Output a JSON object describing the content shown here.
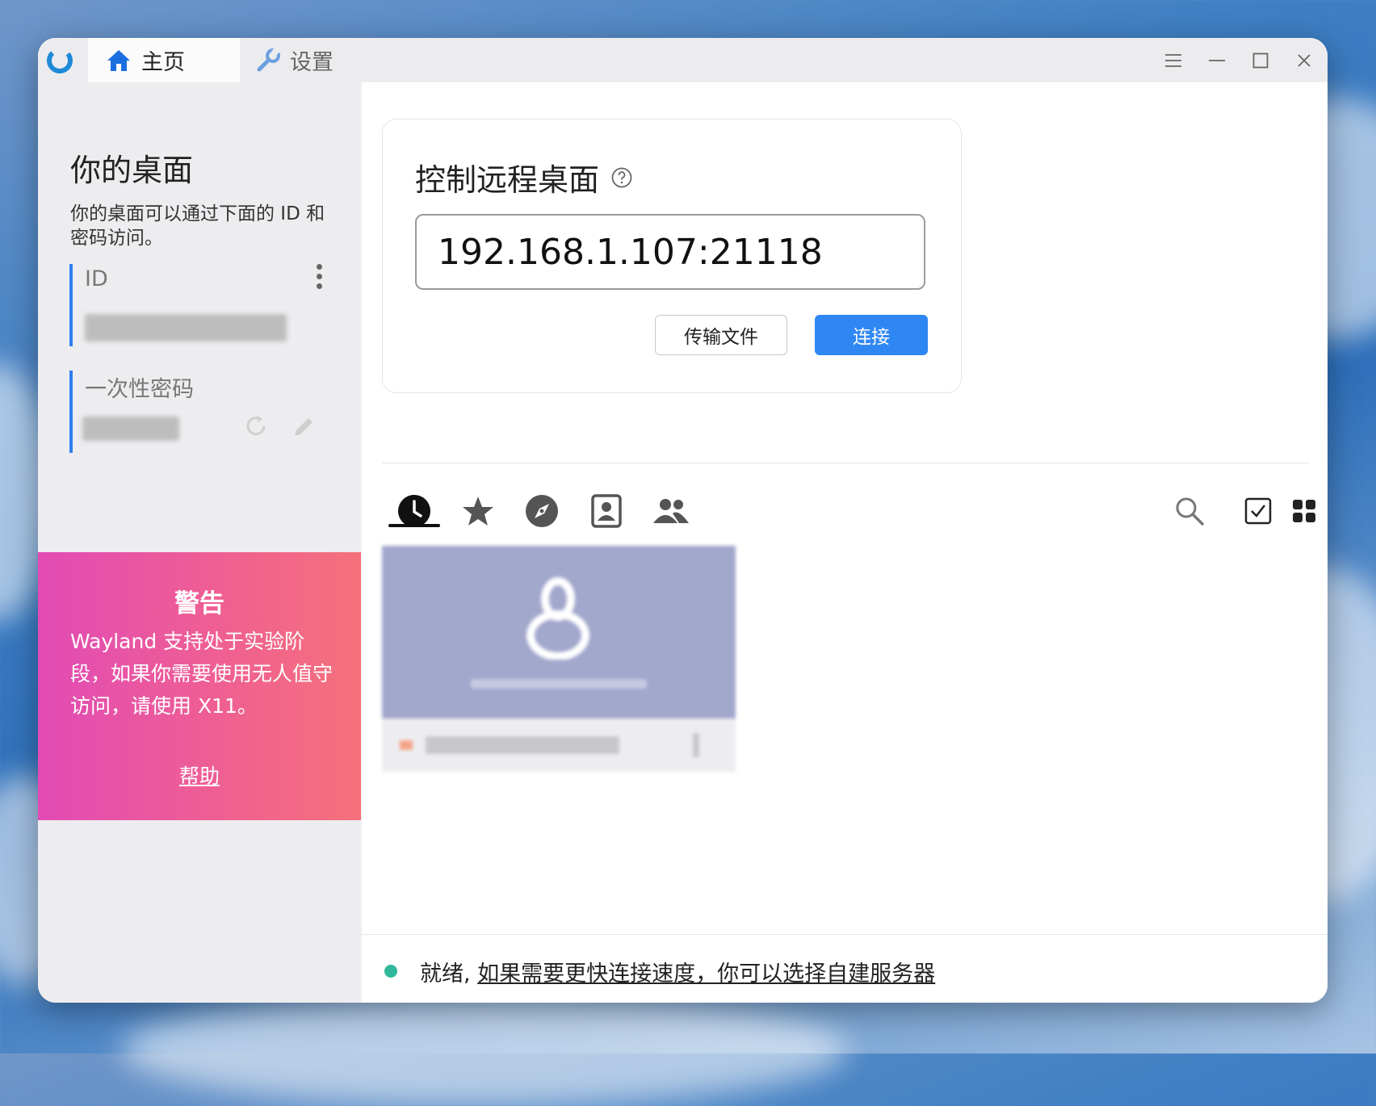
{
  "tabs": {
    "home": "主页",
    "settings": "设置"
  },
  "sidebar": {
    "title": "你的桌面",
    "description": "你的桌面可以通过下面的 ID 和密码访问。",
    "id_label": "ID",
    "password_label": "一次性密码"
  },
  "warning": {
    "title": "警告",
    "body": "Wayland 支持处于实验阶段，如果你需要使用无人值守访问，请使用 X11。",
    "help": "帮助"
  },
  "connect": {
    "title": "控制远程桌面",
    "input_value": "192.168.1.107:21118",
    "transfer_button": "传输文件",
    "connect_button": "连接"
  },
  "peer_tabs": [
    "recent-sessions",
    "favorites",
    "discovered",
    "address-book",
    "group"
  ],
  "status": {
    "ready": "就绪,",
    "link": "如果需要更快连接速度，你可以选择自建服务器",
    "dot_color": "#2fb89a"
  },
  "colors": {
    "accent": "#2f87f3",
    "warning_gradient_start": "#e14bb5",
    "warning_gradient_end": "#f4717a"
  }
}
